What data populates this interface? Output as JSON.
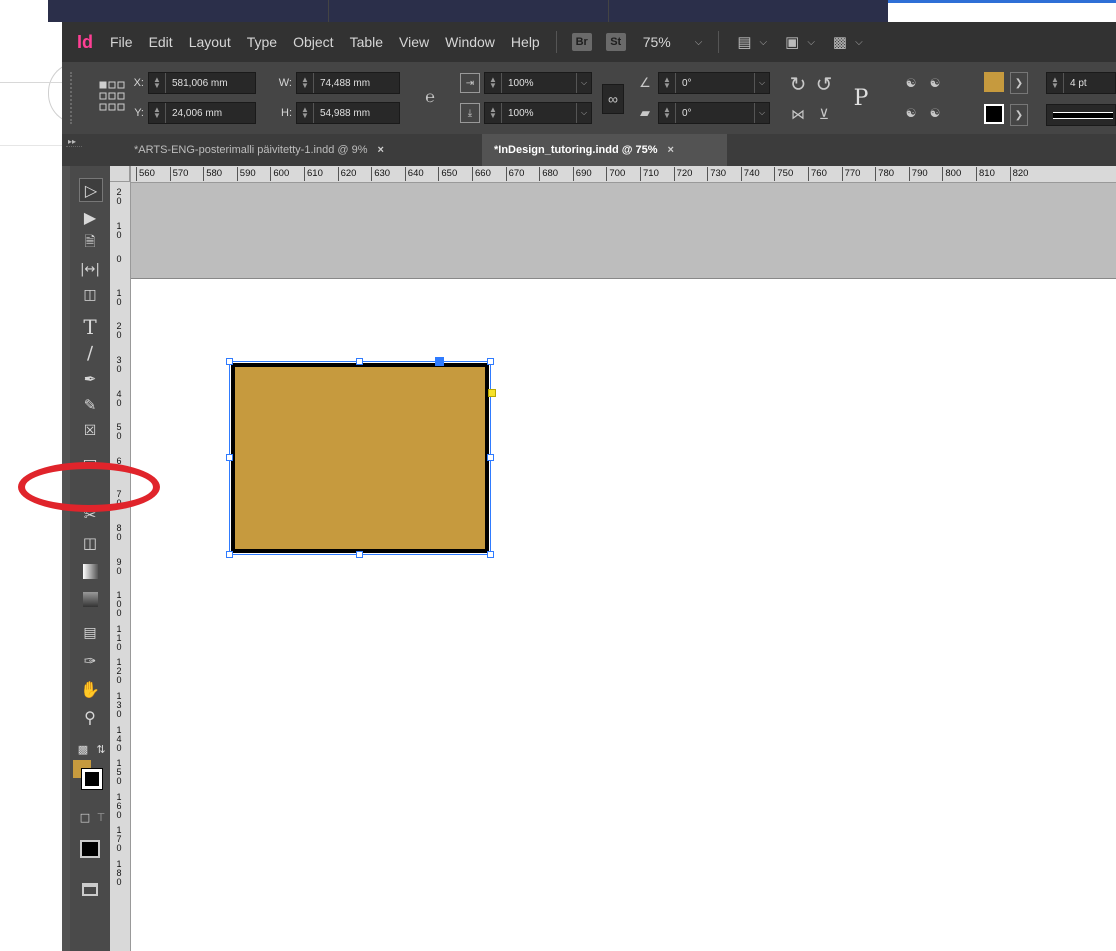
{
  "app": {
    "logo": "Id"
  },
  "menu": [
    "File",
    "Edit",
    "Layout",
    "Type",
    "Object",
    "Table",
    "View",
    "Window",
    "Help"
  ],
  "bridge": {
    "br": "Br",
    "st": "St",
    "zoom": "75%"
  },
  "control": {
    "x_label": "X:",
    "x_value": "581,006 mm",
    "y_label": "Y:",
    "y_value": "24,006 mm",
    "w_label": "W:",
    "w_value": "74,488 mm",
    "h_label": "H:",
    "h_value": "54,988 mm",
    "scale_x": "100%",
    "scale_y": "100%",
    "rotate": "0°",
    "shear": "0°",
    "stroke_weight": "4 pt",
    "fill_color": "#c69a3e",
    "stroke_color": "#000000"
  },
  "tabs": [
    {
      "label": "*ARTS-ENG-posterimalli päivitetty-1.indd @ 9%",
      "close": "×"
    },
    {
      "label": "*InDesign_tutoring.indd @ 75%",
      "close": "×"
    }
  ],
  "ruler": {
    "h": [
      "560",
      "570",
      "580",
      "590",
      "600",
      "610",
      "620",
      "630",
      "640",
      "650",
      "660",
      "670",
      "680",
      "690",
      "700",
      "710",
      "720",
      "730",
      "740",
      "750",
      "760",
      "770",
      "780",
      "790",
      "800",
      "810",
      "820"
    ],
    "v": [
      "2\n0",
      "1\n0",
      "0",
      "1\n0",
      "2\n0",
      "3\n0",
      "4\n0",
      "5\n0",
      "6",
      "7\n0",
      "8\n0",
      "9\n0",
      "1\n0\n0",
      "1\n1\n0",
      "1\n2\n0",
      "1\n3\n0",
      "1\n4\n0",
      "1\n5\n0",
      "1\n6\n0",
      "1\n7\n0",
      "1\n8\n0"
    ]
  },
  "tools": [
    "selection-tool",
    "direct-selection-tool",
    "page-tool",
    "gap-tool",
    "content-collector-tool",
    "type-tool",
    "line-tool",
    "pen-tool",
    "pencil-tool",
    "rectangle-frame-tool",
    "rectangle-tool",
    "scissors-tool",
    "free-transform-tool",
    "gradient-swatch-tool",
    "gradient-feather-tool",
    "note-tool",
    "eyedropper-tool",
    "hand-tool",
    "zoom-tool"
  ],
  "colors": {
    "accent_annotation": "#e0242b",
    "selection": "#2f7bff",
    "fill": "#c69a3e"
  }
}
